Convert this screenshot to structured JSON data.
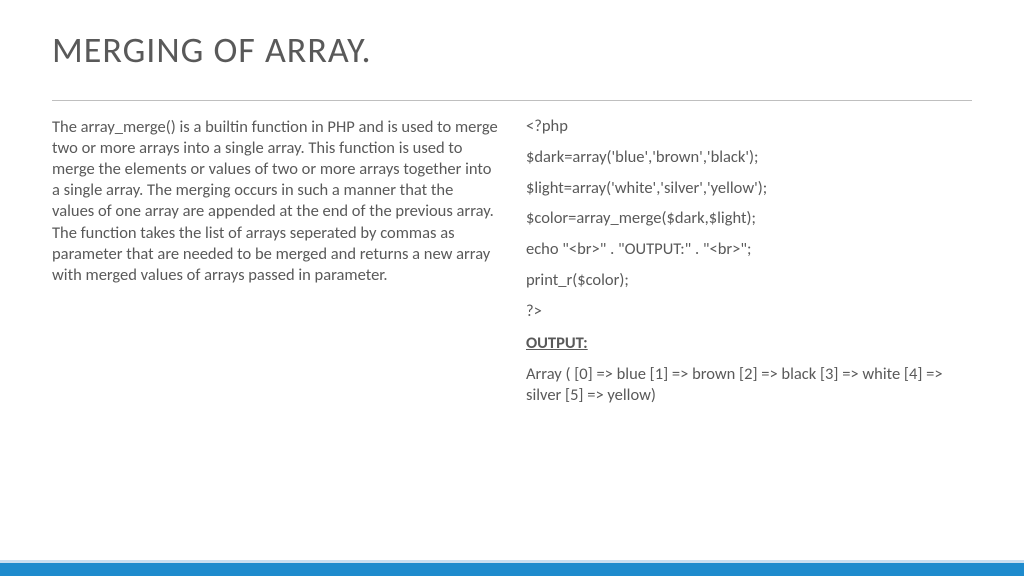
{
  "title": "MERGING OF ARRAY.",
  "description": "The array_merge() is a builtin function in PHP and is used to merge two or more arrays into a single array. This function is used to merge the elements or values of two or more arrays together into a single array. The merging occurs in such a manner that the values of one array are appended at the end of the previous array. The function takes the list of arrays seperated by commas as parameter that are needed to be merged and returns a new array with merged values of arrays passed in parameter.",
  "code": {
    "lines": [
      "<?php",
      "$dark=array('blue','brown','black');",
      "$light=array('white','silver','yellow');",
      "$color=array_merge($dark,$light);",
      "echo \"<br>\" . \"OUTPUT:\" . \"<br>\";",
      "print_r($color);",
      "?>"
    ]
  },
  "output": {
    "label": "OUTPUT:",
    "text": "Array ( [0] => blue [1] => brown [2] => black [3] => white [4] => silver [5] => yellow)"
  },
  "accent_color": "#1e8bcd"
}
